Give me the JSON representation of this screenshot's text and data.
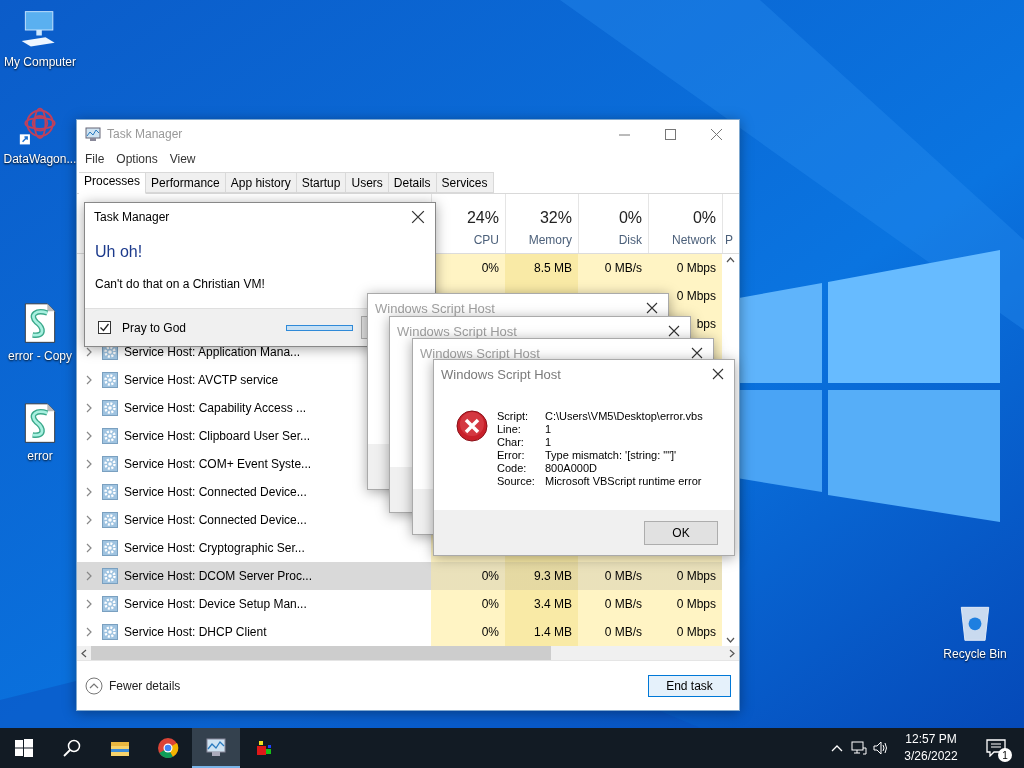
{
  "desktop_icons": [
    {
      "label": "My Computer",
      "kind": "computer"
    },
    {
      "label": "DataWagon...",
      "kind": "app"
    },
    {
      "label": "error - Copy",
      "kind": "script"
    },
    {
      "label": "error",
      "kind": "script"
    },
    {
      "label": "Recycle Bin",
      "kind": "bin"
    }
  ],
  "task_manager": {
    "title": "Task Manager",
    "menu": [
      "File",
      "Options",
      "View"
    ],
    "tabs": [
      {
        "label": "Processes",
        "selected": true
      },
      {
        "label": "Performance",
        "selected": false
      },
      {
        "label": "App history",
        "selected": false
      },
      {
        "label": "Startup",
        "selected": false
      },
      {
        "label": "Users",
        "selected": false
      },
      {
        "label": "Details",
        "selected": false
      },
      {
        "label": "Services",
        "selected": false
      }
    ],
    "columns": [
      {
        "usage": "24%",
        "label": "CPU"
      },
      {
        "usage": "32%",
        "label": "Memory"
      },
      {
        "usage": "0%",
        "label": "Disk"
      },
      {
        "usage": "0%",
        "label": "Network"
      }
    ],
    "column_6": "P",
    "rows": [
      {
        "selected": false,
        "cpu": "0%",
        "memory": "8.5 MB",
        "disk": "0 MB/s",
        "network": "0 Mbps"
      },
      {
        "selected": false,
        "network": "0 Mbps"
      },
      {
        "selected": false,
        "network": "bps"
      },
      {
        "name": "Service Host: Application Mana...",
        "selected": false
      },
      {
        "name": "Service Host: AVCTP service",
        "selected": false
      },
      {
        "name": "Service Host: Capability Access ...",
        "selected": false
      },
      {
        "name": "Service Host: Clipboard User Ser...",
        "selected": false
      },
      {
        "name": "Service Host: COM+ Event Syste...",
        "selected": false
      },
      {
        "name": "Service Host: Connected Device...",
        "selected": false
      },
      {
        "name": "Service Host: Connected Device...",
        "selected": false
      },
      {
        "name": "Service Host: Cryptographic Ser...",
        "selected": false
      },
      {
        "name": "Service Host: DCOM Server Proc...",
        "selected": true,
        "cpu": "0%",
        "memory": "9.3 MB",
        "disk": "0 MB/s",
        "network": "0 Mbps"
      },
      {
        "name": "Service Host: Device Setup Man...",
        "selected": false,
        "cpu": "0%",
        "memory": "3.4 MB",
        "disk": "0 MB/s",
        "network": "0 Mbps"
      },
      {
        "name": "Service Host: DHCP Client",
        "selected": false,
        "cpu": "0%",
        "memory": "1.4 MB",
        "disk": "0 MB/s",
        "network": "0 Mbps"
      }
    ],
    "footer": {
      "fewer_details": "Fewer details",
      "end_task": "End task"
    }
  },
  "alert_dialog": {
    "title": "Task Manager",
    "heading": "Uh oh!",
    "message": "Can't do that on a Christian VM!",
    "checkbox": {
      "label": "Pray to God",
      "checked": true
    },
    "progress": {
      "level": 1
    }
  },
  "script_dialogs": [
    {
      "title": "Windows Script Host"
    },
    {
      "title": "Windows Script Host"
    },
    {
      "title": "Windows Script Host"
    },
    {
      "title": "Windows Script Host",
      "fields": [
        {
          "label": "Script:",
          "value": "C:\\Users\\VM5\\Desktop\\error.vbs"
        },
        {
          "label": "Line:",
          "value": "1"
        },
        {
          "label": "Char:",
          "value": "1"
        },
        {
          "label": "Error:",
          "value": "Type mismatch: '[string: \"\"]'"
        },
        {
          "label": "Code:",
          "value": "800A000D"
        },
        {
          "label": "Source:",
          "value": "Microsoft VBScript runtime error"
        }
      ],
      "button": "OK"
    }
  ],
  "taskbar": {
    "apps": [
      {
        "kind": "start",
        "active": false
      },
      {
        "kind": "search",
        "active": false
      },
      {
        "kind": "folder",
        "active": false
      },
      {
        "kind": "browser",
        "active": false
      },
      {
        "kind": "taskmgr",
        "active": true
      },
      {
        "kind": "app",
        "active": false
      }
    ],
    "time": "12:57 PM",
    "date": "3/26/2022",
    "notifications": "1"
  }
}
